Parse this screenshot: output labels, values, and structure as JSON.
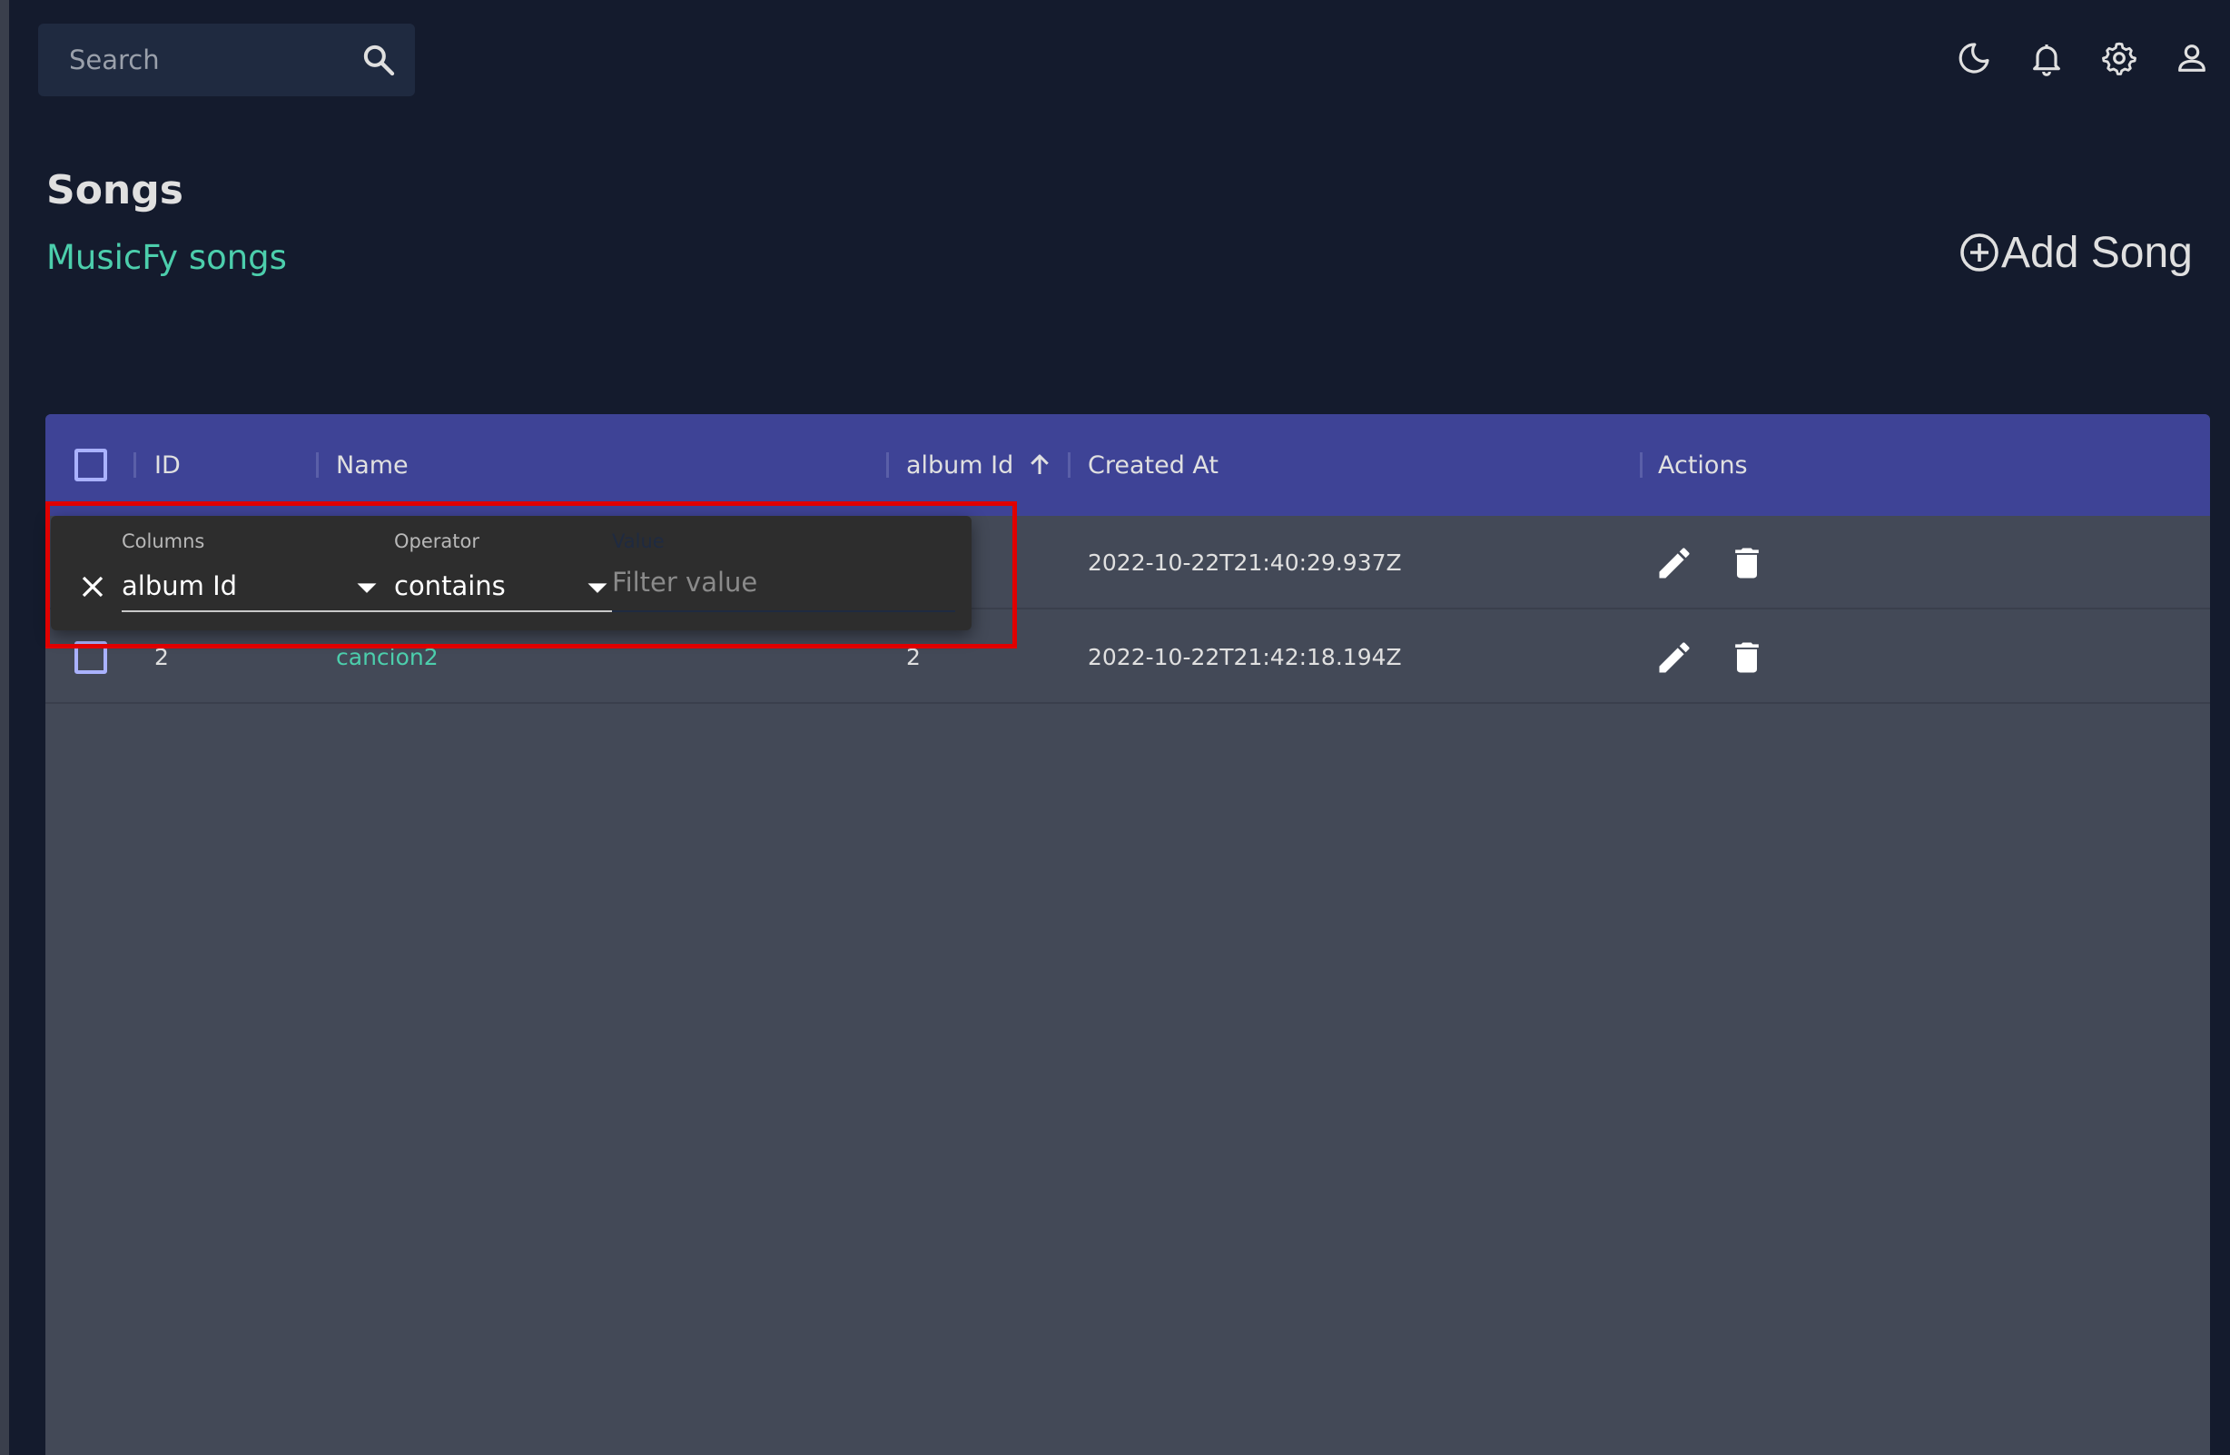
{
  "search": {
    "placeholder": "Search"
  },
  "header": {
    "title": "Songs",
    "subtitle": "MusicFy songs",
    "add_button_label": "Add Song"
  },
  "grid": {
    "columns": [
      "ID",
      "Name",
      "album Id",
      "Created At",
      "Actions"
    ],
    "sorted_column": "album Id",
    "sort_direction": "ascending",
    "rows": [
      {
        "id": "",
        "name": "",
        "album_id": "",
        "created_at": "2022-10-22T21:40:29.937Z"
      },
      {
        "id": "2",
        "name": "cancion2",
        "album_id": "2",
        "created_at": "2022-10-22T21:42:18.194Z"
      }
    ]
  },
  "filter": {
    "columns_label": "Columns",
    "column_value": "album Id",
    "operator_label": "Operator",
    "operator_value": "contains",
    "value_label": "Value",
    "value_placeholder": "Filter value"
  },
  "colors": {
    "background": "#141b2d",
    "accent": "#4cceac",
    "header": "#3e4396",
    "panel": "#2d2d2d",
    "highlight": "#e00000"
  },
  "icons": {
    "top_bar": [
      "moon-icon",
      "bell-icon",
      "gear-icon",
      "user-icon"
    ],
    "row_actions": [
      "pencil-icon",
      "trash-icon"
    ]
  }
}
